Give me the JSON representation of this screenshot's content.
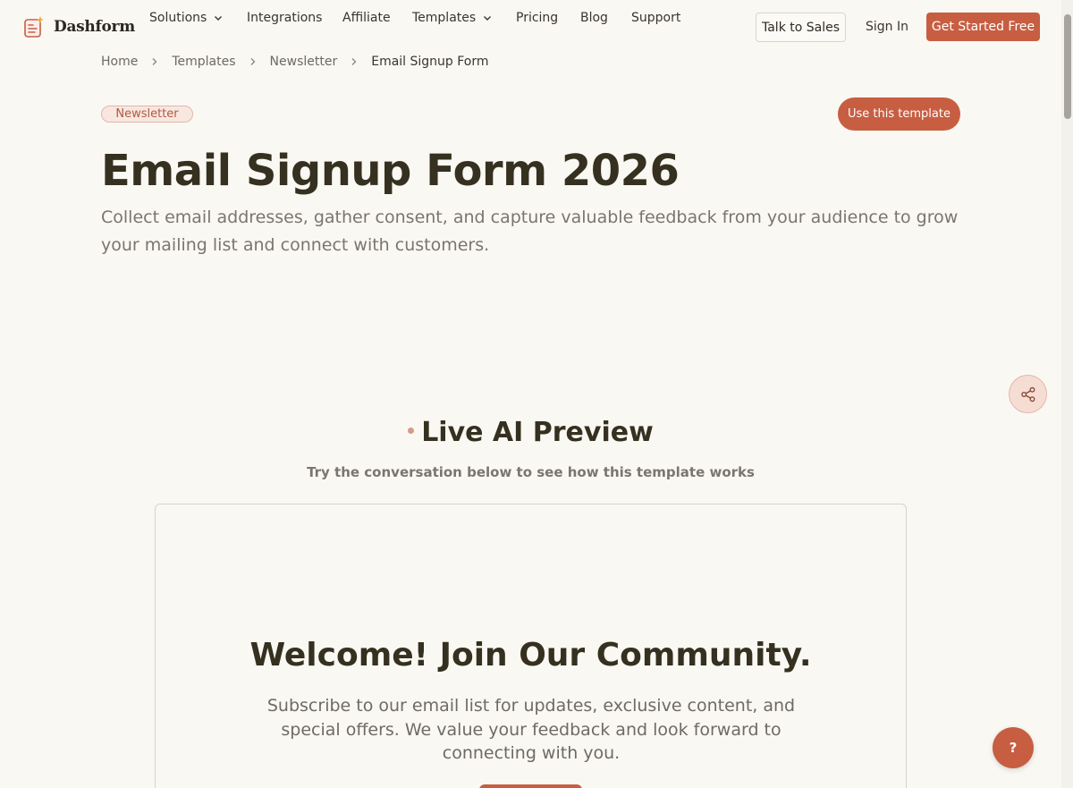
{
  "brand": {
    "name": "Dashform",
    "logo_icon": "form-sparkle-icon",
    "accent_color": "#c75e42"
  },
  "nav": {
    "solutions": "Solutions",
    "integrations": "Integrations",
    "affiliate": "Affiliate",
    "templates": "Templates",
    "pricing": "Pricing",
    "blog": "Blog",
    "support": "Support"
  },
  "header_actions": {
    "talk_to_sales": "Talk to Sales",
    "sign_in": "Sign In",
    "get_started": "Get Started Free"
  },
  "breadcrumb": [
    "Home",
    "Templates",
    "Newsletter",
    "Email Signup Form"
  ],
  "hero": {
    "tag": "Newsletter",
    "use_template": "Use this template",
    "title": "Email Signup Form 2026",
    "description": "Collect email addresses, gather consent, and capture valuable feedback from your audience to grow your mailing list and connect with customers."
  },
  "preview": {
    "heading": "Live AI Preview",
    "subheading": "Try the conversation below to see how this template works",
    "card_title": "Welcome! Join Our Community.",
    "card_description": "Subscribe to our email list for updates, exclusive content, and special offers. We value your feedback and look forward to connecting with you."
  },
  "floating": {
    "share_icon": "share-icon",
    "help_label": "?"
  }
}
